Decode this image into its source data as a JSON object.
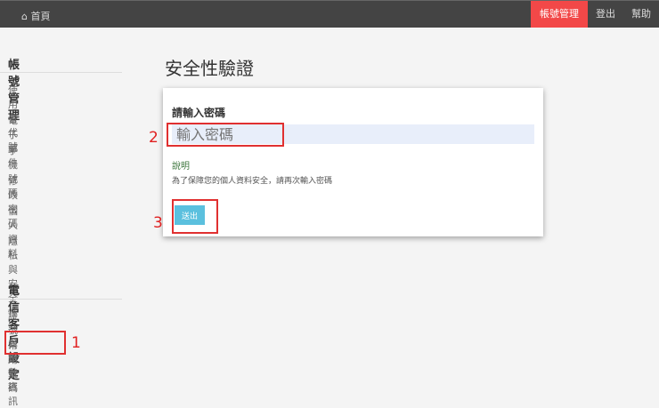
{
  "navbar": {
    "home_icon": "home-icon",
    "home": "首頁",
    "items": [
      "帳號管理",
      "登出",
      "幫助"
    ],
    "active_color": "#f24848"
  },
  "sidebar": {
    "sections": [
      {
        "heading": "帳號管理",
        "items": [
          "使用者代號",
          "電子郵件",
          "手機號碼",
          "修改密碼",
          "個人資料",
          "隱私與安全性"
        ]
      },
      {
        "heading": "電信客戶設定",
        "items": [
          "證號與點數資訊",
          "常用號碼"
        ]
      }
    ]
  },
  "main": {
    "title": "安全性驗證",
    "label": "請輸入密碼",
    "placeholder": "輸入密碼",
    "help_title": "說明",
    "help_text": "為了保障您的個人資料安全，請再次輸入密碼",
    "submit": "送出"
  },
  "annotations": [
    "1",
    "2",
    "3"
  ]
}
